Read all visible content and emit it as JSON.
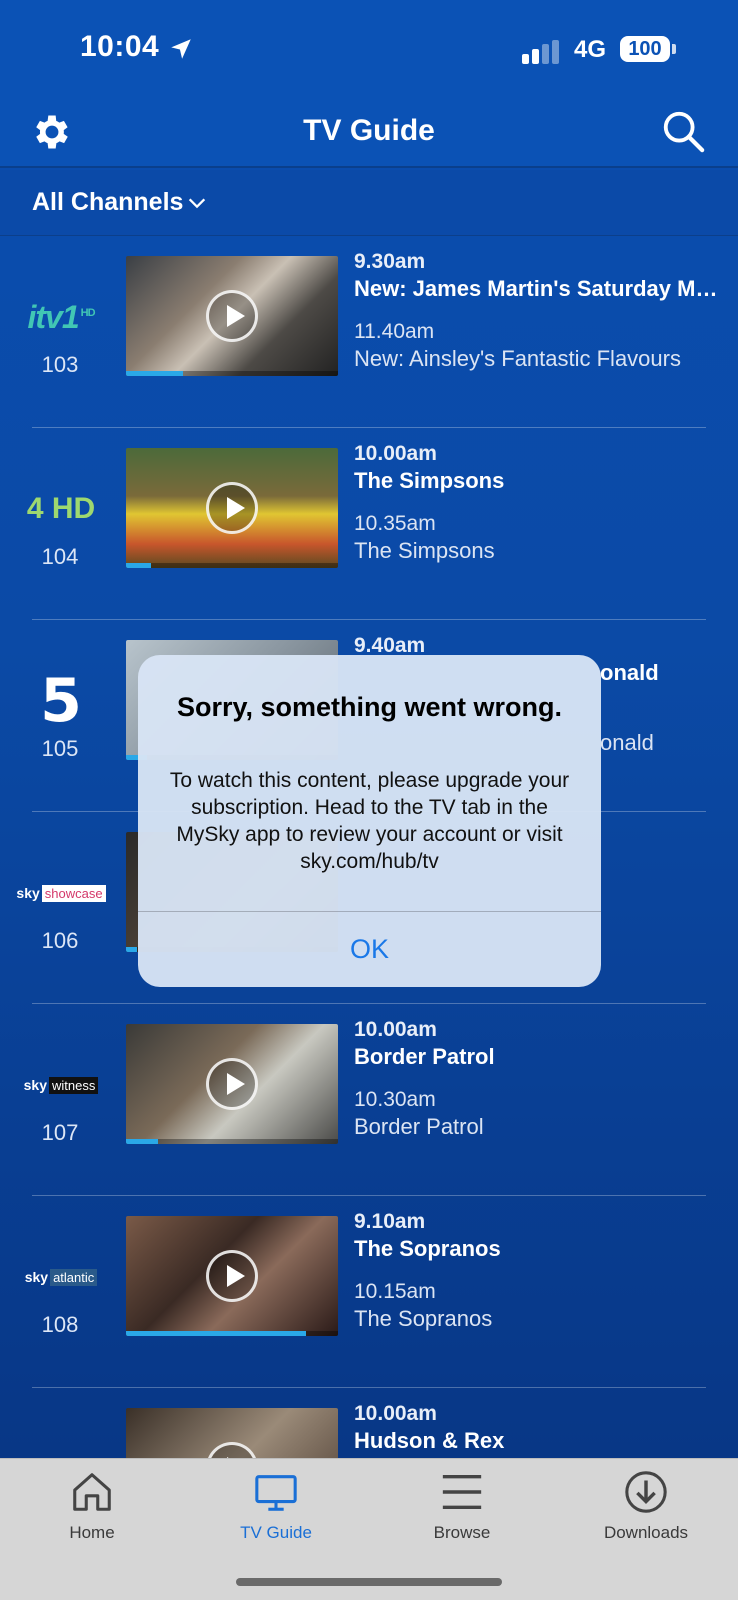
{
  "status_bar": {
    "time": "10:04",
    "network": "4G",
    "battery": "100"
  },
  "header": {
    "title": "TV Guide"
  },
  "filter": {
    "label": "All Channels"
  },
  "channels": [
    {
      "logo": "itv1",
      "logo_text": "itv1",
      "logo_sub": "HD",
      "number": "103",
      "time1": "9.30am",
      "prog1": "New: James Martin's Saturday Morning",
      "time2": "11.40am",
      "prog2": "New: Ainsley's Fantastic Flavours",
      "progress": 0.27
    },
    {
      "logo": "channel4-hd",
      "logo_text": "4 HD",
      "number": "104",
      "time1": "10.00am",
      "prog1": "The Simpsons",
      "time2": "10.35am",
      "prog2": "The Simpsons",
      "progress": 0.12
    },
    {
      "logo": "channel5",
      "logo_text": "5",
      "number": "105",
      "time1": "9.40am",
      "prog1": "onald",
      "time2": "",
      "prog2": "onald",
      "progress": 0.1
    },
    {
      "logo": "sky-showcase",
      "logo_text": "sky",
      "logo_tag": "showcase",
      "number": "106",
      "time1": "",
      "prog1": "",
      "time2": "",
      "prog2": "",
      "progress": 0.05
    },
    {
      "logo": "sky-witness",
      "logo_text": "sky",
      "logo_tag": "witness",
      "number": "107",
      "time1": "10.00am",
      "prog1": "Border Patrol",
      "time2": "10.30am",
      "prog2": "Border Patrol",
      "progress": 0.15
    },
    {
      "logo": "sky-atlantic",
      "logo_text": "sky",
      "logo_tag": "atlantic",
      "number": "108",
      "time1": "9.10am",
      "prog1": "The Sopranos",
      "time2": "10.15am",
      "prog2": "The Sopranos",
      "progress": 0.85
    },
    {
      "logo": "unknown",
      "logo_text": "",
      "number": "",
      "time1": "10.00am",
      "prog1": "Hudson & Rex",
      "time2": "",
      "prog2": "",
      "progress": 0.1
    }
  ],
  "dialog": {
    "title": "Sorry, something went wrong.",
    "message": "To watch this content, please upgrade your subscription. Head to the TV tab in the MySky app to review your account or visit sky.com/hub/tv",
    "ok": "OK"
  },
  "tabs": [
    {
      "label": "Home",
      "icon": "house-icon",
      "active": false
    },
    {
      "label": "TV Guide",
      "icon": "tv-icon",
      "active": true
    },
    {
      "label": "Browse",
      "icon": "menu-lines-icon",
      "active": false
    },
    {
      "label": "Downloads",
      "icon": "download-icon",
      "active": false
    }
  ],
  "colors": {
    "accent": "#1a78e8",
    "background": "#0b4aa8",
    "progress": "#2aa8e8"
  }
}
